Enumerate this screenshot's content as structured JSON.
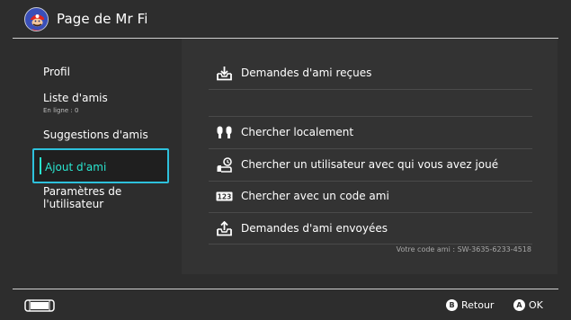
{
  "header": {
    "title": "Page de Mr Fi"
  },
  "sidebar": {
    "items": [
      {
        "label": "Profil"
      },
      {
        "label": "Liste d'amis",
        "sub": "En ligne : 0"
      },
      {
        "label": "Suggestions d'amis"
      },
      {
        "label": "Ajout d'ami",
        "selected": true
      },
      {
        "label_line1": "Paramètres de",
        "label_line2": "l'utilisateur"
      }
    ]
  },
  "main": {
    "options": [
      {
        "label": "Demandes d'ami reçues",
        "icon": "inbox-download-icon"
      },
      {
        "label": "Chercher localement",
        "icon": "local-users-icon"
      },
      {
        "label": "Chercher un utilisateur avec qui vous avez joué",
        "icon": "played-with-icon"
      },
      {
        "label": "Chercher avec un code ami",
        "icon": "friend-code-123-icon"
      },
      {
        "label": "Demandes d'ami envoyées",
        "icon": "outbox-upload-icon"
      }
    ],
    "friend_code": "Votre code ami : SW-3635-6233-4518"
  },
  "footer": {
    "back_key": "B",
    "back_label": "Retour",
    "ok_key": "A",
    "ok_label": "OK"
  },
  "colors": {
    "background": "#2d2d2d",
    "panel": "#333333",
    "accent": "#2ae6d0",
    "selection_border": "#2ec1dc"
  }
}
